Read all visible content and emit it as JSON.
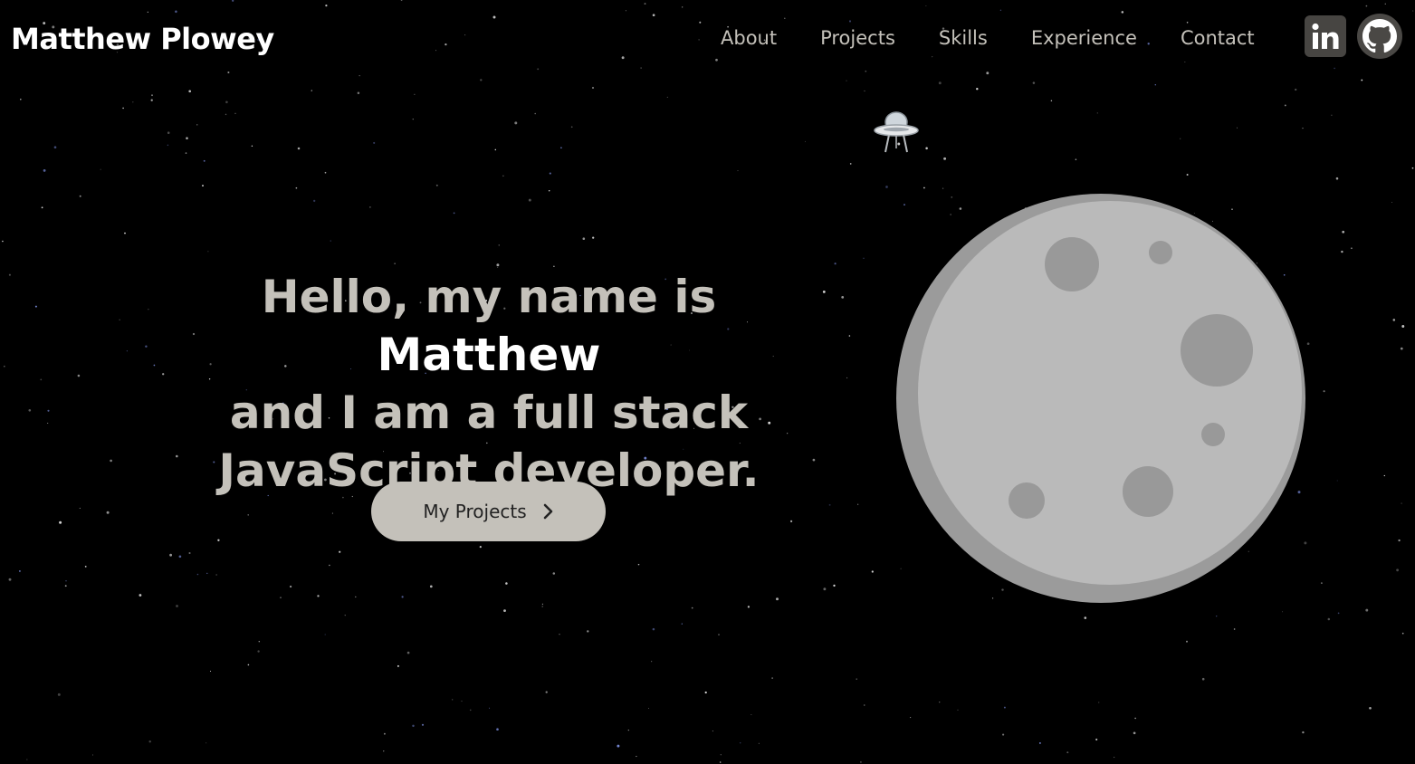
{
  "header": {
    "brand": "Matthew Plowey",
    "nav": [
      "About",
      "Projects",
      "Skills",
      "Experience",
      "Contact"
    ],
    "social": {
      "linkedin_icon": "linkedin-icon",
      "github_icon": "github-icon"
    }
  },
  "hero": {
    "intro": "Hello, my name is ",
    "name": "Matthew",
    "line2": "and I am a full stack",
    "line3": "JavaScript developer.",
    "button_label": "My Projects",
    "button_icon": "chevron-right-icon"
  },
  "decor": {
    "ufo_icon": "ufo-icon",
    "moon_icon": "moon-illustration"
  },
  "colors": {
    "background": "#000000",
    "text": "#c4c1ba",
    "highlight": "#ffffff",
    "button": "#c4c1ba",
    "moon": "#b9b9b9",
    "crater": "#999999"
  }
}
